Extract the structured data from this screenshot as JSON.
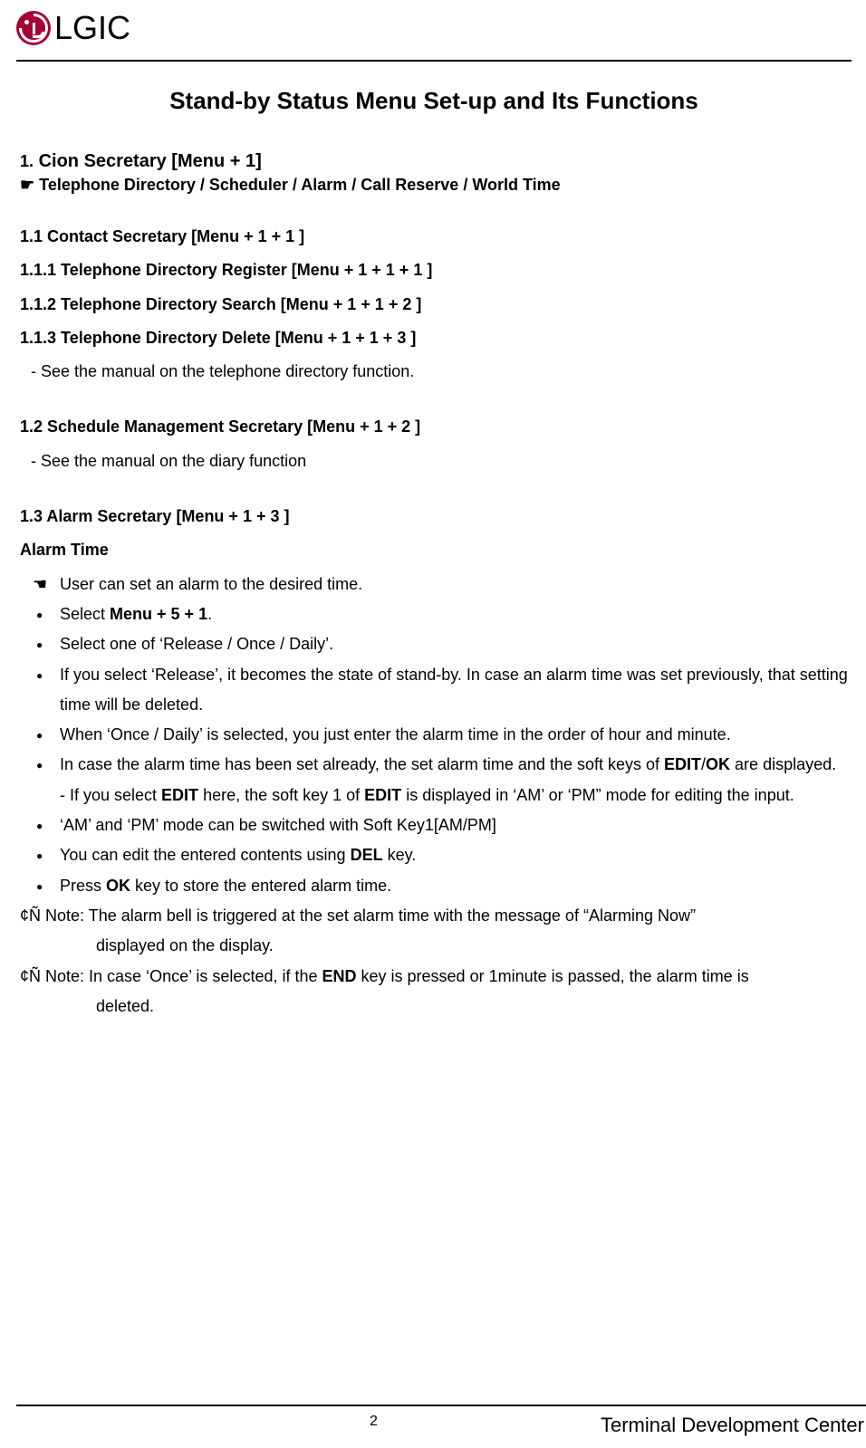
{
  "header": {
    "logo_text": "LGIC"
  },
  "title": "Stand-by Status Menu Set-up and Its Functions",
  "sec1": {
    "num": "1.",
    "head": "Cion Secretary [Menu + 1]",
    "pointer": "☛",
    "pointer_text": "Telephone Directory / Scheduler / Alarm / Call Reserve / World Time"
  },
  "sec11": {
    "head": "1.1   Contact Secretary [Menu + 1 + 1 ]",
    "h111": "1.1.1 Telephone Directory Register [Menu + 1 + 1 + 1 ]",
    "h112": "1.1.2 Telephone Directory Search [Menu + 1 + 1 + 2 ]",
    "h113": "1.1.3 Telephone Directory Delete [Menu + 1 + 1 + 3 ]",
    "dash": "-     See the manual on the telephone directory function."
  },
  "sec12": {
    "head": "1.2   Schedule Management Secretary [Menu + 1 + 2 ]",
    "dash": "-   See the manual on the diary function"
  },
  "sec13": {
    "head": "1.3   Alarm Secretary [Menu + 1 + 3 ]",
    "subhead": "Alarm Time",
    "li_pointer": "User can set an alarm to the desired time.",
    "li1_a": "Select ",
    "li1_b": "Menu + 5 + 1",
    "li1_c": ".",
    "li2": "Select one of ‘Release / Once / Daily’.",
    "li3": "If you select ‘Release’, it becomes the state of stand-by. In case an alarm time was set previously, that setting time will be deleted.",
    "li4": "When ‘Once / Daily’ is selected, you just enter the alarm time in the order of hour and minute.",
    "li5_a": "In case the alarm time has been set already, the set alarm time and the soft keys of ",
    "li5_b": "EDIT",
    "li5_c": "/",
    "li5_d": "OK",
    "li5_e": " are displayed.",
    "li5_sub_a": "- If you select ",
    "li5_sub_b": "EDIT",
    "li5_sub_c": " here, the soft key 1 of ",
    "li5_sub_d": "EDIT",
    "li5_sub_e": " is displayed in ‘AM’ or ‘PM” mode for editing the input.",
    "li6": "‘AM’ and ‘PM’ mode can be switched with Soft Key1[AM/PM]",
    "li7_a": "You can edit the entered contents using ",
    "li7_b": "DEL",
    "li7_c": " key.",
    "li8_a": "Press ",
    "li8_b": "OK",
    "li8_c": " key to store the entered alarm time.",
    "note1_a": "¢Ñ Note: The alarm bell is triggered at the set alarm time with the message of “Alarming Now”",
    "note1_b": "displayed on the display.",
    "note2_a1": "¢Ñ Note: In case ‘Once’ is selected, if the ",
    "note2_a2": "END",
    "note2_a3": " key is pressed or 1minute is passed, the alarm time is",
    "note2_b": "deleted."
  },
  "footer": {
    "page": "2",
    "text": "Terminal Development Center"
  }
}
